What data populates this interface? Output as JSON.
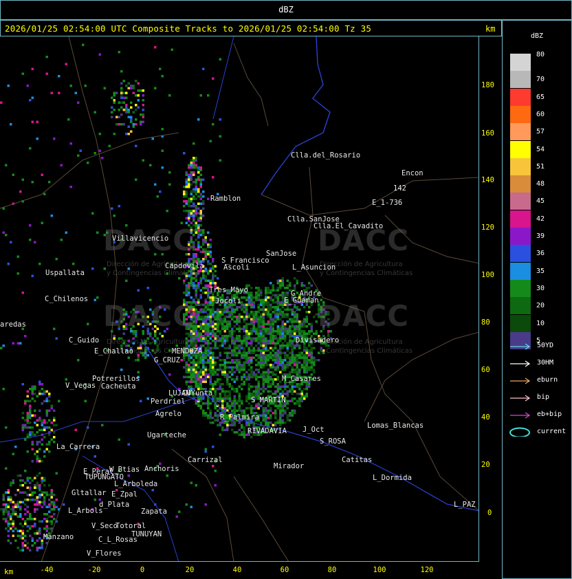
{
  "header": {
    "unit_title": "dBZ",
    "status_line": "2026/01/25 02:54:00 UTC Composite Tracks to 2026/01/25 02:54:00 Tz 35",
    "km_label": "km"
  },
  "axes": {
    "y_ticks": [
      "180",
      "160",
      "140",
      "120",
      "100",
      "80",
      "60",
      "40",
      "20",
      "0"
    ],
    "x_ticks": [
      "-40",
      "-20",
      "0",
      "20",
      "40",
      "60",
      "80",
      "100",
      "120"
    ],
    "x_unit": "km"
  },
  "legend": {
    "title": "dBZ",
    "scale": [
      {
        "label": "80",
        "color": "#d4d4d4"
      },
      {
        "label": "70",
        "color": "#b8b8b8"
      },
      {
        "label": "65",
        "color": "#ff3b2f"
      },
      {
        "label": "60",
        "color": "#ff6a10"
      },
      {
        "label": "57",
        "color": "#ff9a5c"
      },
      {
        "label": "54",
        "color": "#ffff00"
      },
      {
        "label": "51",
        "color": "#f7c43a"
      },
      {
        "label": "48",
        "color": "#d98c3a"
      },
      {
        "label": "45",
        "color": "#c86a8c"
      },
      {
        "label": "42",
        "color": "#d8158c"
      },
      {
        "label": "39",
        "color": "#8a18c8"
      },
      {
        "label": "36",
        "color": "#2a50e0"
      },
      {
        "label": "35",
        "color": "#1a8ee0"
      },
      {
        "label": "30",
        "color": "#148a1a"
      },
      {
        "label": "20",
        "color": "#0e6a10"
      },
      {
        "label": "10",
        "color": "#0b4a0b"
      },
      {
        "label": "5",
        "color": "#4a3a8a"
      }
    ],
    "tracks": [
      {
        "label": "50YD",
        "color": "#5fd8e0"
      },
      {
        "label": "30HM",
        "color": "#ffffff"
      },
      {
        "label": "eburn",
        "color": "#e8a860"
      },
      {
        "label": "bip",
        "color": "#ffc0cb"
      },
      {
        "label": "eb+bip",
        "color": "#e040e0"
      },
      {
        "label": "current",
        "color": "#40e0e0"
      }
    ]
  },
  "watermarks": {
    "brand": "DACC",
    "line1": "Dirección de Agricultura",
    "line2": "y Contingencias Climáticas"
  },
  "places": [
    {
      "name": "Clla.del_Rosario"
    },
    {
      "name": "Encon"
    },
    {
      "name": "142"
    },
    {
      "name": "E_1-736"
    },
    {
      "name": "Ramblon"
    },
    {
      "name": "Clla.SanJose"
    },
    {
      "name": "Clla.El_Cavadito"
    },
    {
      "name": "Villavicencio"
    },
    {
      "name": "SanJose"
    },
    {
      "name": "S_Francisco"
    },
    {
      "name": "Capdevila"
    },
    {
      "name": "Ascoli"
    },
    {
      "name": "L_Asuncion"
    },
    {
      "name": "Uspallata"
    },
    {
      "name": "Tres_Mayo"
    },
    {
      "name": "G_Andre"
    },
    {
      "name": "C_Chilenos"
    },
    {
      "name": "Jocoli"
    },
    {
      "name": "E_Guaman"
    },
    {
      "name": "aredas"
    },
    {
      "name": "Divisadero"
    },
    {
      "name": "C_Guido"
    },
    {
      "name": "E_Challao"
    },
    {
      "name": "MENDOZA"
    },
    {
      "name": "G_CRUZ"
    },
    {
      "name": "Potrerillos"
    },
    {
      "name": "Cacheuta"
    },
    {
      "name": "V_Vegas"
    },
    {
      "name": "LUJAN"
    },
    {
      "name": "CUYunta"
    },
    {
      "name": "Perdriel"
    },
    {
      "name": "M_Casares"
    },
    {
      "name": "S_MARTIN"
    },
    {
      "name": "Agrelo"
    },
    {
      "name": "R_Palmira"
    },
    {
      "name": "Lomas_Blancas"
    },
    {
      "name": "Ugarteche"
    },
    {
      "name": "La_Carrera"
    },
    {
      "name": "RIVADAVIA"
    },
    {
      "name": "J_Oct"
    },
    {
      "name": "S_ROSA"
    },
    {
      "name": "Carrizal"
    },
    {
      "name": "Catitas"
    },
    {
      "name": "E_Peral"
    },
    {
      "name": "W_Btias"
    },
    {
      "name": "Anchoris"
    },
    {
      "name": "TUPUNGATO"
    },
    {
      "name": "L_Arboleda"
    },
    {
      "name": "L_Dormida"
    },
    {
      "name": "Gltallar"
    },
    {
      "name": "E_Zpal"
    },
    {
      "name": "Mirador"
    },
    {
      "name": "d_Plata"
    },
    {
      "name": "L_Arbols"
    },
    {
      "name": "Zapata"
    },
    {
      "name": "L_PAZ"
    },
    {
      "name": "V_Seco"
    },
    {
      "name": "Totoral"
    },
    {
      "name": "TUNUYAN"
    },
    {
      "name": "Manzano"
    },
    {
      "name": "C_L_Rosas"
    },
    {
      "name": "V_Flores"
    }
  ]
}
